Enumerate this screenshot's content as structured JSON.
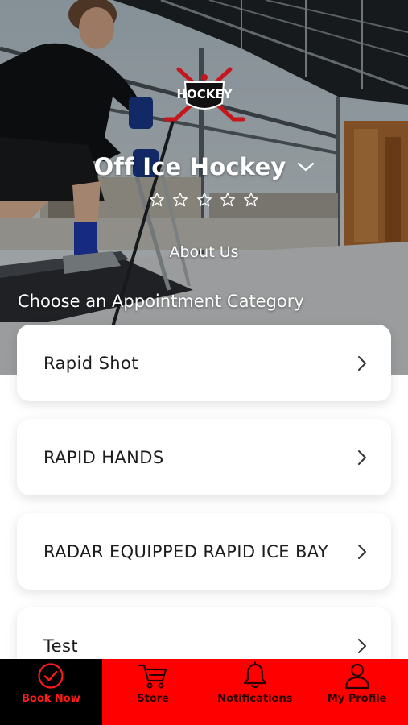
{
  "business": {
    "name": "Off Ice Hockey",
    "logo_text": "HOCKEY",
    "rating_stars": 5,
    "rating_value": 0,
    "about_link": "About Us"
  },
  "categories": {
    "heading": "Choose an Appointment Category",
    "items": [
      {
        "label": "Rapid Shot"
      },
      {
        "label": "RAPID HANDS"
      },
      {
        "label": "RADAR EQUIPPED RAPID ICE BAY"
      },
      {
        "label": "Test"
      }
    ]
  },
  "tabbar": {
    "tabs": [
      {
        "label": "Book Now",
        "icon": "check-circle-icon",
        "active": true
      },
      {
        "label": "Store",
        "icon": "cart-icon",
        "active": false
      },
      {
        "label": "Notifications",
        "icon": "bell-icon",
        "active": false
      },
      {
        "label": "My Profile",
        "icon": "user-icon",
        "active": false
      }
    ]
  },
  "colors": {
    "accent": "#ff0000",
    "active_tab_bg": "#000000",
    "card_bg": "#ffffff"
  }
}
